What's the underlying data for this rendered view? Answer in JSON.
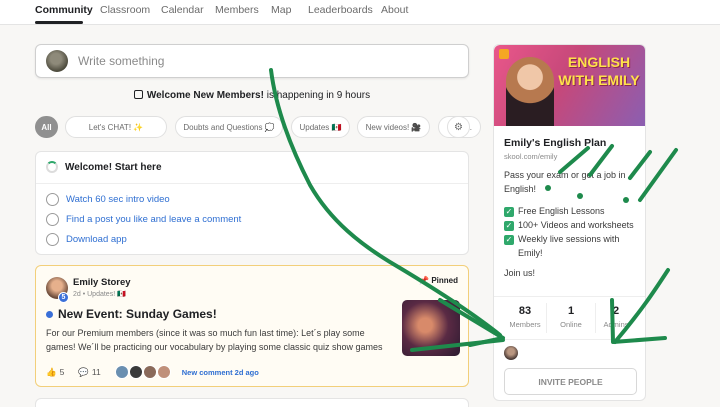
{
  "nav": {
    "tabs": [
      "Community",
      "Classroom",
      "Calendar",
      "Members",
      "Map",
      "Leaderboards",
      "About"
    ],
    "active": "Community"
  },
  "composer": {
    "placeholder": "Write something"
  },
  "announcement": {
    "title": "Welcome New Members!",
    "suffix": " is happening in 9 hours"
  },
  "filters": [
    "All",
    "Let's CHAT! ✨",
    "Doubts and Questions 💭",
    "Updates 🇲🇽",
    "New videos! 🎥",
    "More..."
  ],
  "onboarding": {
    "title": "Welcome! Start here",
    "tasks": [
      "Watch 60 sec intro video",
      "Find a post you like and leave a comment",
      "Download app"
    ]
  },
  "post": {
    "author": "Emily Storey",
    "level": "5",
    "meta": "2d • Updates! 🇲🇽",
    "pinned": "Pinned",
    "title": "New Event: Sunday Games!",
    "body": "For our Premium members (since it was so much fun last time): Let´s play some games! We´ll be practicing our vocabulary by playing some classic quiz show games",
    "likes": "5",
    "comments": "11",
    "new_comment": "New comment 2d ago"
  },
  "group": {
    "banner_text": "ENGLISH WITH EMILY",
    "name": "Emily's English Plan",
    "url": "skool.com/emily",
    "description": "Pass your exam or get a job in English!",
    "features": [
      "Free English Lessons",
      "100+ Videos and worksheets",
      "Weekly live sessions with Emily!"
    ],
    "join": "Join us!",
    "stats": [
      {
        "value": "83",
        "label": "Members"
      },
      {
        "value": "1",
        "label": "Online"
      },
      {
        "value": "2",
        "label": "Admins"
      }
    ],
    "invite": "INVITE PEOPLE"
  },
  "colors": {
    "accent_green": "#2fa86b",
    "link_blue": "#2f6fd2",
    "pinned_border": "#f2cf7a",
    "annotation": "#1e8a4c"
  }
}
